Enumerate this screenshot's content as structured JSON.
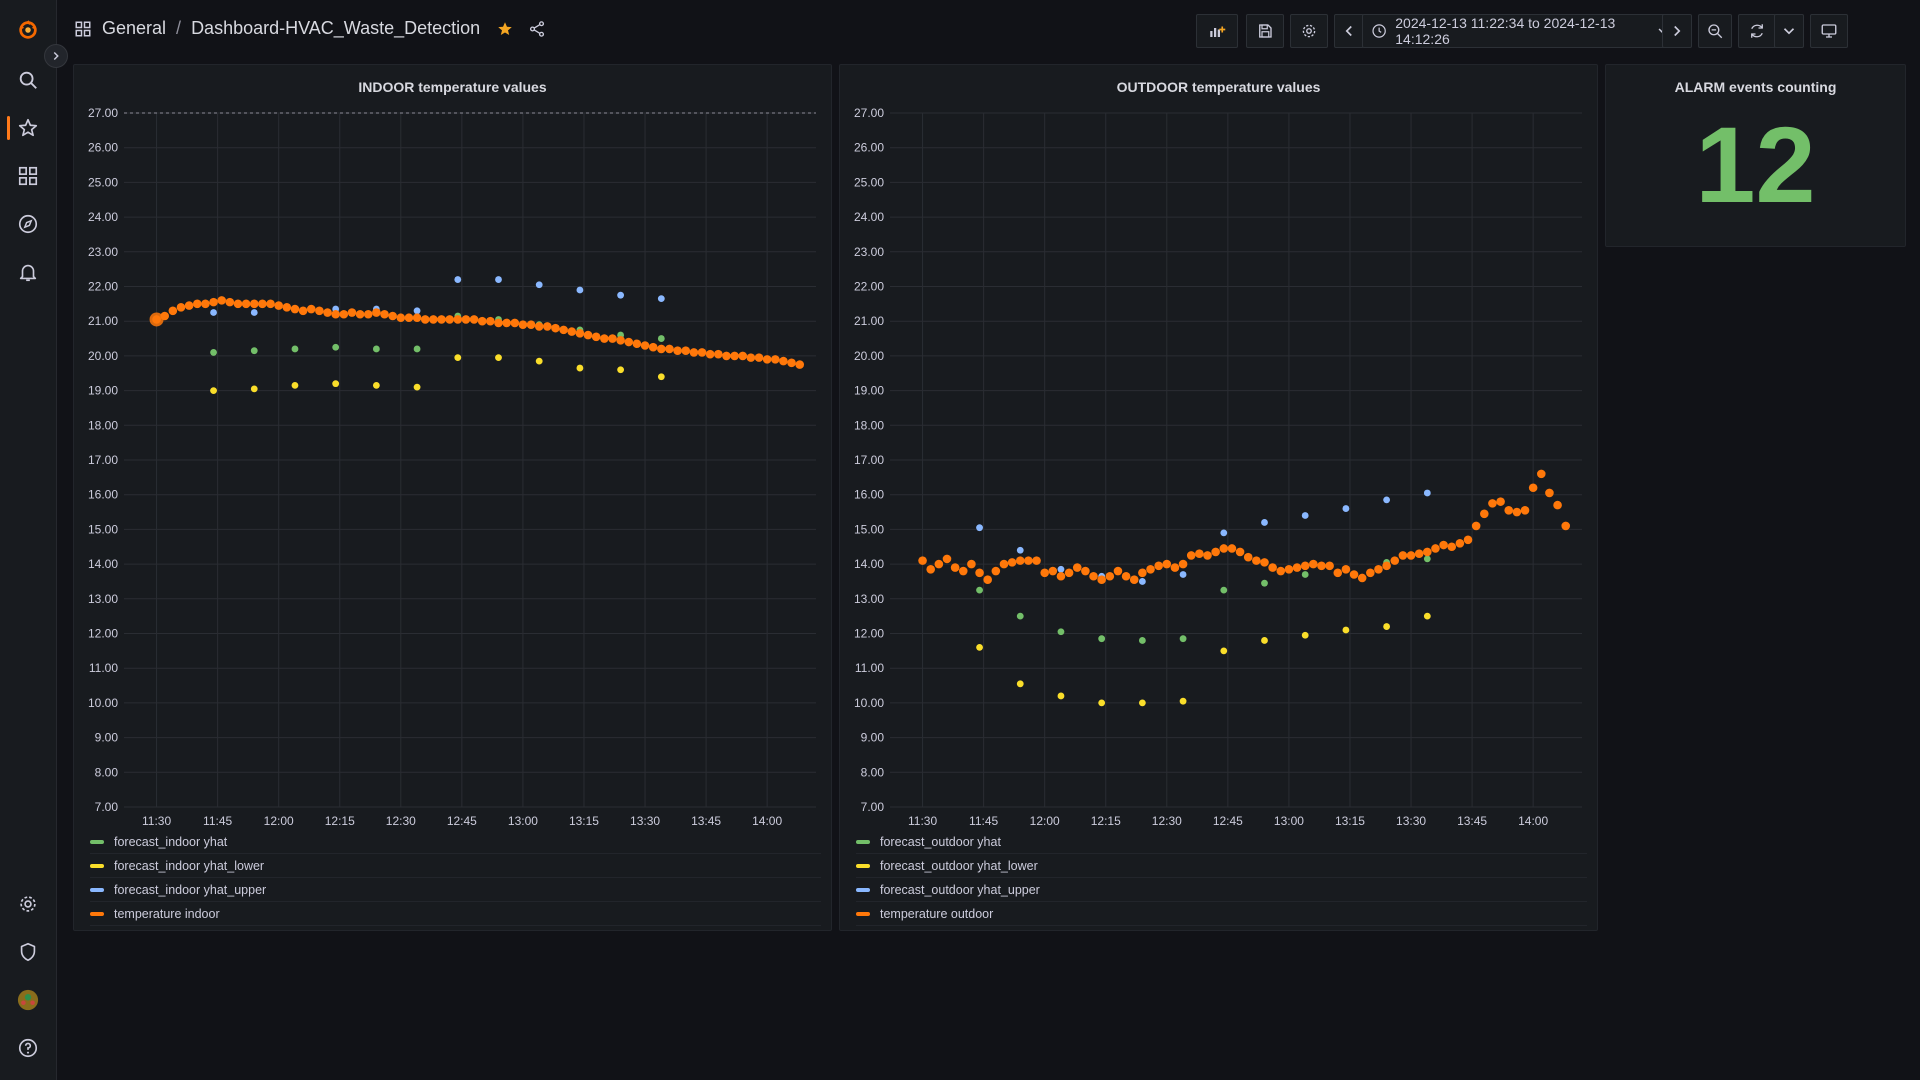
{
  "breadcrumb": {
    "folder": "General",
    "separator": "/",
    "dashboard": "Dashboard-HVAC_Waste_Detection"
  },
  "timepicker": {
    "range": "2024-12-13 11:22:34 to 2024-12-13 14:12:26"
  },
  "icons": {
    "sidebar": [
      "grafana-logo-icon",
      "search-icon",
      "star-icon",
      "dashboards-icon",
      "explore-icon",
      "alerting-icon",
      "config-gear-icon",
      "shield-icon",
      "user-avatar-icon",
      "help-icon"
    ],
    "toolbar": [
      "add-panel-icon",
      "save-icon",
      "settings-gear-icon",
      "chevron-left-icon",
      "clock-icon",
      "chevron-down-icon",
      "chevron-right-icon",
      "zoom-out-icon",
      "refresh-icon",
      "tv-mode-icon"
    ]
  },
  "colors": {
    "yhat": "#73bf69",
    "yhat_lower": "#fade2a",
    "yhat_upper": "#8ab8ff",
    "temperature": "#ff780a",
    "stat": "#73bf69",
    "accent": "#ff7a1a"
  },
  "stat_panel": {
    "title": "ALARM events counting",
    "value": "12"
  },
  "chart_data": [
    {
      "type": "scatter",
      "title": "INDOOR temperature values",
      "ylim": [
        7,
        27
      ],
      "yticks": [
        "7.00",
        "8.00",
        "9.00",
        "10.00",
        "11.00",
        "12.00",
        "13.00",
        "14.00",
        "15.00",
        "16.00",
        "17.00",
        "18.00",
        "19.00",
        "20.00",
        "21.00",
        "22.00",
        "23.00",
        "24.00",
        "25.00",
        "26.00",
        "27.00"
      ],
      "xlim": [
        "11:22",
        "14:12"
      ],
      "xticks": [
        "11:30",
        "11:45",
        "12:00",
        "12:15",
        "12:30",
        "12:45",
        "13:00",
        "13:15",
        "13:30",
        "13:45",
        "14:00"
      ],
      "grid": true,
      "legend_position": "bottom",
      "threshold": 27,
      "series": [
        {
          "name": "forecast_indoor yhat",
          "color": "#73bf69",
          "x": [
            "11:44",
            "11:54",
            "12:04",
            "12:14",
            "12:24",
            "12:34",
            "12:44",
            "12:54",
            "13:04",
            "13:14",
            "13:24",
            "13:34"
          ],
          "y": [
            20.1,
            20.15,
            20.2,
            20.25,
            20.2,
            20.2,
            21.15,
            21.05,
            20.9,
            20.75,
            20.6,
            20.5
          ]
        },
        {
          "name": "forecast_indoor yhat_lower",
          "color": "#fade2a",
          "x": [
            "11:44",
            "11:54",
            "12:04",
            "12:14",
            "12:24",
            "12:34",
            "12:44",
            "12:54",
            "13:04",
            "13:14",
            "13:24",
            "13:34"
          ],
          "y": [
            19.0,
            19.05,
            19.15,
            19.2,
            19.15,
            19.1,
            19.95,
            19.95,
            19.85,
            19.65,
            19.6,
            19.4
          ]
        },
        {
          "name": "forecast_indoor yhat_upper",
          "color": "#8ab8ff",
          "x": [
            "11:44",
            "11:54",
            "12:04",
            "12:14",
            "12:24",
            "12:34",
            "12:44",
            "12:54",
            "13:04",
            "13:14",
            "13:24",
            "13:34"
          ],
          "y": [
            21.25,
            21.25,
            21.35,
            21.35,
            21.35,
            21.3,
            22.2,
            22.2,
            22.05,
            21.9,
            21.75,
            21.65
          ]
        },
        {
          "name": "temperature indoor",
          "color": "#ff780a",
          "x": [
            "11:30",
            "11:32",
            "11:34",
            "11:36",
            "11:38",
            "11:40",
            "11:42",
            "11:44",
            "11:46",
            "11:48",
            "11:50",
            "11:52",
            "11:54",
            "11:56",
            "11:58",
            "12:00",
            "12:02",
            "12:04",
            "12:06",
            "12:08",
            "12:10",
            "12:12",
            "12:14",
            "12:16",
            "12:18",
            "12:20",
            "12:22",
            "12:24",
            "12:26",
            "12:28",
            "12:30",
            "12:32",
            "12:34",
            "12:36",
            "12:38",
            "12:40",
            "12:42",
            "12:44",
            "12:46",
            "12:48",
            "12:50",
            "12:52",
            "12:54",
            "12:56",
            "12:58",
            "13:00",
            "13:02",
            "13:04",
            "13:06",
            "13:08",
            "13:10",
            "13:12",
            "13:14",
            "13:16",
            "13:18",
            "13:20",
            "13:22",
            "13:24",
            "13:26",
            "13:28",
            "13:30",
            "13:32",
            "13:34",
            "13:36",
            "13:38",
            "13:40",
            "13:42",
            "13:44",
            "13:46",
            "13:48",
            "13:50",
            "13:52",
            "13:54",
            "13:56",
            "13:58",
            "14:00",
            "14:02",
            "14:04",
            "14:06",
            "14:08"
          ],
          "y": [
            21.05,
            21.15,
            21.3,
            21.4,
            21.45,
            21.5,
            21.5,
            21.55,
            21.6,
            21.55,
            21.5,
            21.5,
            21.5,
            21.5,
            21.5,
            21.45,
            21.4,
            21.35,
            21.3,
            21.35,
            21.3,
            21.25,
            21.2,
            21.2,
            21.25,
            21.2,
            21.2,
            21.25,
            21.2,
            21.15,
            21.1,
            21.1,
            21.1,
            21.05,
            21.05,
            21.05,
            21.05,
            21.05,
            21.05,
            21.05,
            21.0,
            21.0,
            20.95,
            20.95,
            20.95,
            20.9,
            20.9,
            20.85,
            20.85,
            20.8,
            20.75,
            20.7,
            20.65,
            20.6,
            20.55,
            20.5,
            20.5,
            20.45,
            20.4,
            20.35,
            20.3,
            20.25,
            20.2,
            20.2,
            20.15,
            20.15,
            20.1,
            20.1,
            20.05,
            20.05,
            20.0,
            20.0,
            20.0,
            19.95,
            19.95,
            19.9,
            19.9,
            19.85,
            19.8,
            19.75
          ]
        }
      ]
    },
    {
      "type": "scatter",
      "title": "OUTDOOR temperature values",
      "ylim": [
        7,
        27
      ],
      "yticks": [
        "7.00",
        "8.00",
        "9.00",
        "10.00",
        "11.00",
        "12.00",
        "13.00",
        "14.00",
        "15.00",
        "16.00",
        "17.00",
        "18.00",
        "19.00",
        "20.00",
        "21.00",
        "22.00",
        "23.00",
        "24.00",
        "25.00",
        "26.00",
        "27.00"
      ],
      "xlim": [
        "11:22",
        "14:12"
      ],
      "xticks": [
        "11:30",
        "11:45",
        "12:00",
        "12:15",
        "12:30",
        "12:45",
        "13:00",
        "13:15",
        "13:30",
        "13:45",
        "14:00"
      ],
      "grid": true,
      "legend_position": "bottom",
      "series": [
        {
          "name": "forecast_outdoor yhat",
          "color": "#73bf69",
          "x": [
            "11:44",
            "11:54",
            "12:04",
            "12:14",
            "12:24",
            "12:34",
            "12:44",
            "12:54",
            "13:04",
            "13:14",
            "13:24",
            "13:34"
          ],
          "y": [
            13.25,
            12.5,
            12.05,
            11.85,
            11.8,
            11.85,
            13.25,
            13.45,
            13.7,
            13.85,
            14.05,
            14.15
          ]
        },
        {
          "name": "forecast_outdoor yhat_lower",
          "color": "#fade2a",
          "x": [
            "11:44",
            "11:54",
            "12:04",
            "12:14",
            "12:24",
            "12:34",
            "12:44",
            "12:54",
            "13:04",
            "13:14",
            "13:24",
            "13:34"
          ],
          "y": [
            11.6,
            10.55,
            10.2,
            10.0,
            10.0,
            10.05,
            11.5,
            11.8,
            11.95,
            12.1,
            12.2,
            12.5
          ]
        },
        {
          "name": "forecast_outdoor yhat_upper",
          "color": "#8ab8ff",
          "x": [
            "11:44",
            "11:54",
            "12:04",
            "12:14",
            "12:24",
            "12:34",
            "12:44",
            "12:54",
            "13:04",
            "13:14",
            "13:24",
            "13:34"
          ],
          "y": [
            15.05,
            14.4,
            13.85,
            13.65,
            13.5,
            13.7,
            14.9,
            15.2,
            15.4,
            15.6,
            15.85,
            16.05
          ]
        },
        {
          "name": "temperature outdoor",
          "color": "#ff780a",
          "x": [
            "11:30",
            "11:32",
            "11:34",
            "11:36",
            "11:38",
            "11:40",
            "11:42",
            "11:44",
            "11:46",
            "11:48",
            "11:50",
            "11:52",
            "11:54",
            "11:56",
            "11:58",
            "12:00",
            "12:02",
            "12:04",
            "12:06",
            "12:08",
            "12:10",
            "12:12",
            "12:14",
            "12:16",
            "12:18",
            "12:20",
            "12:22",
            "12:24",
            "12:26",
            "12:28",
            "12:30",
            "12:32",
            "12:34",
            "12:36",
            "12:38",
            "12:40",
            "12:42",
            "12:44",
            "12:46",
            "12:48",
            "12:50",
            "12:52",
            "12:54",
            "12:56",
            "12:58",
            "13:00",
            "13:02",
            "13:04",
            "13:06",
            "13:08",
            "13:10",
            "13:12",
            "13:14",
            "13:16",
            "13:18",
            "13:20",
            "13:22",
            "13:24",
            "13:26",
            "13:28",
            "13:30",
            "13:32",
            "13:34",
            "13:36",
            "13:38",
            "13:40",
            "13:42",
            "13:44",
            "13:46",
            "13:48",
            "13:50",
            "13:52",
            "13:54",
            "13:56",
            "13:58",
            "14:00",
            "14:02",
            "14:04",
            "14:06",
            "14:08"
          ],
          "y": [
            14.1,
            13.85,
            14.0,
            14.15,
            13.9,
            13.8,
            14.0,
            13.75,
            13.55,
            13.8,
            14.0,
            14.05,
            14.1,
            14.1,
            14.1,
            13.75,
            13.8,
            13.65,
            13.75,
            13.9,
            13.8,
            13.65,
            13.55,
            13.65,
            13.8,
            13.65,
            13.55,
            13.75,
            13.85,
            13.95,
            14.0,
            13.9,
            14.0,
            14.25,
            14.3,
            14.25,
            14.35,
            14.45,
            14.45,
            14.35,
            14.2,
            14.1,
            14.05,
            13.9,
            13.8,
            13.85,
            13.9,
            13.95,
            14.0,
            13.95,
            13.95,
            13.75,
            13.85,
            13.7,
            13.6,
            13.75,
            13.85,
            13.95,
            14.1,
            14.25,
            14.25,
            14.3,
            14.35,
            14.45,
            14.55,
            14.5,
            14.6,
            14.7,
            15.1,
            15.45,
            15.75,
            15.8,
            15.55,
            15.5,
            15.55,
            16.2,
            16.6,
            16.05,
            15.7,
            15.1
          ]
        }
      ]
    }
  ]
}
